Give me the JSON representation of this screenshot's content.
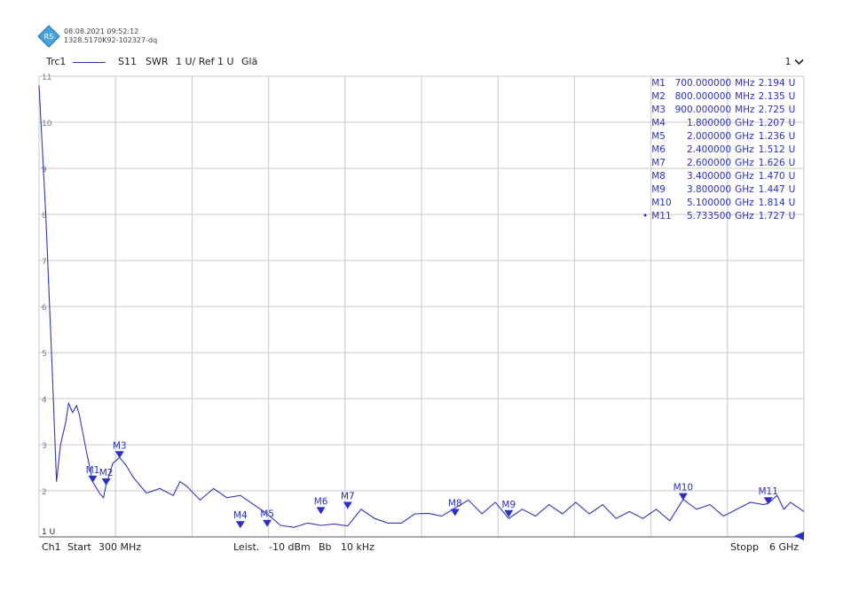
{
  "header": {
    "timestamp": "08.08.2021 09:52:12",
    "device_id": "1328.5170K92-102327-dq",
    "logo_text": "RS"
  },
  "trace_bar": {
    "trace": "Trc1",
    "param": "S11",
    "format": "SWR",
    "scale": "1 U/ Ref 1 U",
    "smoothing": "Glä",
    "selector": "1",
    "selector_icon": "chevron-down-icon"
  },
  "footer": {
    "channel": "Ch1",
    "start_label": "Start",
    "start_value": "300 MHz",
    "power_label": "Leist.",
    "power_value": "-10 dBm",
    "bw_label": "Bb",
    "bw_value": "10 kHz",
    "stop_label": "Stopp",
    "stop_value": "6 GHz"
  },
  "colors": {
    "trace": "#3236b8",
    "marker": "#2b2fc4",
    "grid": "#c8c8c8",
    "axis": "#555555"
  },
  "chart_data": {
    "type": "line",
    "x_unit": "GHz",
    "xlim": [
      0.3,
      6.0
    ],
    "ylim": [
      1,
      11
    ],
    "grid": true,
    "y_ticks": [
      "11",
      "10",
      "9",
      "8",
      "7",
      "6",
      "5",
      "4",
      "3",
      "2",
      "1 U"
    ],
    "y_tick_values": [
      11,
      10,
      9,
      8,
      7,
      6,
      5,
      4,
      3,
      2,
      1
    ],
    "series": [
      {
        "values": [
          [
            0.3,
            10.8
          ],
          [
            0.35,
            8.0
          ],
          [
            0.4,
            4.5
          ],
          [
            0.43,
            2.2
          ],
          [
            0.46,
            3.0
          ],
          [
            0.5,
            3.5
          ],
          [
            0.52,
            3.9
          ],
          [
            0.55,
            3.7
          ],
          [
            0.58,
            3.85
          ],
          [
            0.6,
            3.65
          ],
          [
            0.65,
            2.9
          ],
          [
            0.7,
            2.194
          ],
          [
            0.75,
            1.95
          ],
          [
            0.78,
            1.85
          ],
          [
            0.8,
            2.135
          ],
          [
            0.85,
            2.6
          ],
          [
            0.9,
            2.725
          ],
          [
            0.95,
            2.55
          ],
          [
            1.0,
            2.3
          ],
          [
            1.1,
            1.95
          ],
          [
            1.2,
            2.05
          ],
          [
            1.3,
            1.9
          ],
          [
            1.35,
            2.2
          ],
          [
            1.4,
            2.1
          ],
          [
            1.5,
            1.8
          ],
          [
            1.6,
            2.05
          ],
          [
            1.7,
            1.85
          ],
          [
            1.8,
            1.9
          ],
          [
            1.9,
            1.7
          ],
          [
            2.0,
            1.5
          ],
          [
            2.1,
            1.25
          ],
          [
            2.2,
            1.207
          ],
          [
            2.3,
            1.3
          ],
          [
            2.4,
            1.25
          ],
          [
            2.5,
            1.28
          ],
          [
            2.6,
            1.236
          ],
          [
            2.7,
            1.6
          ],
          [
            2.8,
            1.4
          ],
          [
            2.9,
            1.3
          ],
          [
            3.0,
            1.3
          ],
          [
            3.1,
            1.5
          ],
          [
            3.2,
            1.512
          ],
          [
            3.3,
            1.45
          ],
          [
            3.4,
            1.626
          ],
          [
            3.5,
            1.8
          ],
          [
            3.6,
            1.5
          ],
          [
            3.7,
            1.75
          ],
          [
            3.8,
            1.4
          ],
          [
            3.9,
            1.6
          ],
          [
            4.0,
            1.45
          ],
          [
            4.1,
            1.7
          ],
          [
            4.2,
            1.5
          ],
          [
            4.3,
            1.75
          ],
          [
            4.4,
            1.5
          ],
          [
            4.5,
            1.7
          ],
          [
            4.6,
            1.4
          ],
          [
            4.7,
            1.55
          ],
          [
            4.8,
            1.4
          ],
          [
            4.9,
            1.6
          ],
          [
            5.0,
            1.35
          ],
          [
            5.1,
            1.814
          ],
          [
            5.2,
            1.6
          ],
          [
            5.3,
            1.7
          ],
          [
            5.4,
            1.45
          ],
          [
            5.5,
            1.6
          ],
          [
            5.6,
            1.75
          ],
          [
            5.7,
            1.7
          ],
          [
            5.733,
            1.727
          ],
          [
            5.8,
            1.9
          ],
          [
            5.85,
            1.6
          ],
          [
            5.9,
            1.75
          ],
          [
            6.0,
            1.55
          ]
        ]
      }
    ],
    "markers": [
      {
        "id": "M1",
        "x": 0.7,
        "x_text": "700.000000",
        "unit": "MHz",
        "y": 2.194,
        "y_text": "2.194",
        "y_unit": "U",
        "active": false
      },
      {
        "id": "M2",
        "x": 0.8,
        "x_text": "800.000000",
        "unit": "MHz",
        "y": 2.135,
        "y_text": "2.135",
        "y_unit": "U",
        "active": false
      },
      {
        "id": "M3",
        "x": 0.9,
        "x_text": "900.000000",
        "unit": "MHz",
        "y": 2.725,
        "y_text": "2.725",
        "y_unit": "U",
        "active": false
      },
      {
        "id": "M4",
        "x": 1.8,
        "x_text": "1.800000",
        "unit": "GHz",
        "y": 1.207,
        "y_text": "1.207",
        "y_unit": "U",
        "active": false
      },
      {
        "id": "M5",
        "x": 2.0,
        "x_text": "2.000000",
        "unit": "GHz",
        "y": 1.236,
        "y_text": "1.236",
        "y_unit": "U",
        "active": false
      },
      {
        "id": "M6",
        "x": 2.4,
        "x_text": "2.400000",
        "unit": "GHz",
        "y": 1.512,
        "y_text": "1.512",
        "y_unit": "U",
        "active": false
      },
      {
        "id": "M7",
        "x": 2.6,
        "x_text": "2.600000",
        "unit": "GHz",
        "y": 1.626,
        "y_text": "1.626",
        "y_unit": "U",
        "active": false
      },
      {
        "id": "M8",
        "x": 3.4,
        "x_text": "3.400000",
        "unit": "GHz",
        "y": 1.47,
        "y_text": "1.470",
        "y_unit": "U",
        "active": false
      },
      {
        "id": "M9",
        "x": 3.8,
        "x_text": "3.800000",
        "unit": "GHz",
        "y": 1.447,
        "y_text": "1.447",
        "y_unit": "U",
        "active": false
      },
      {
        "id": "M10",
        "x": 5.1,
        "x_text": "5.100000",
        "unit": "GHz",
        "y": 1.814,
        "y_text": "1.814",
        "y_unit": "U",
        "active": false
      },
      {
        "id": "M11",
        "x": 5.7335,
        "x_text": "5.733500",
        "unit": "GHz",
        "y": 1.727,
        "y_text": "1.727",
        "y_unit": "U",
        "active": true
      }
    ]
  }
}
